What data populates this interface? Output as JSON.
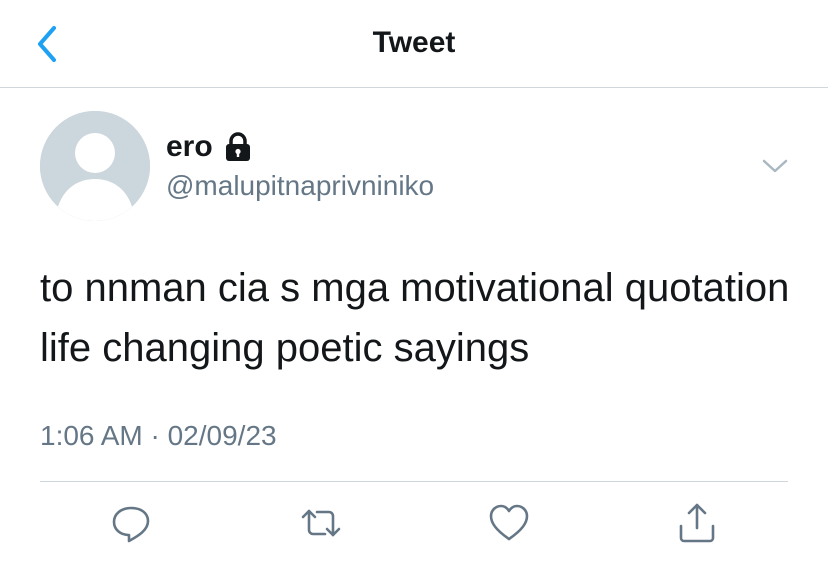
{
  "navbar": {
    "title": "Tweet",
    "back_icon": "chevron-left-icon"
  },
  "tweet": {
    "author": {
      "display_name": "ero",
      "handle": "@malupitnaprivniniko",
      "protected_icon": "lock-icon",
      "avatar": "default-avatar"
    },
    "text": "to nnman cia s mga motivational quotation life changing poetic sayings",
    "timestamp": "1:06 AM · 02/09/23"
  },
  "actions": {
    "reply_icon": "reply-icon",
    "retweet_icon": "retweet-icon",
    "like_icon": "like-icon",
    "share_icon": "share-icon"
  },
  "colors": {
    "accent": "#1da1f2",
    "text": "#14171a",
    "secondary": "#657786",
    "border": "#cfd6dc",
    "avatar_bg": "#ccd6dd",
    "icon": "#657786"
  }
}
